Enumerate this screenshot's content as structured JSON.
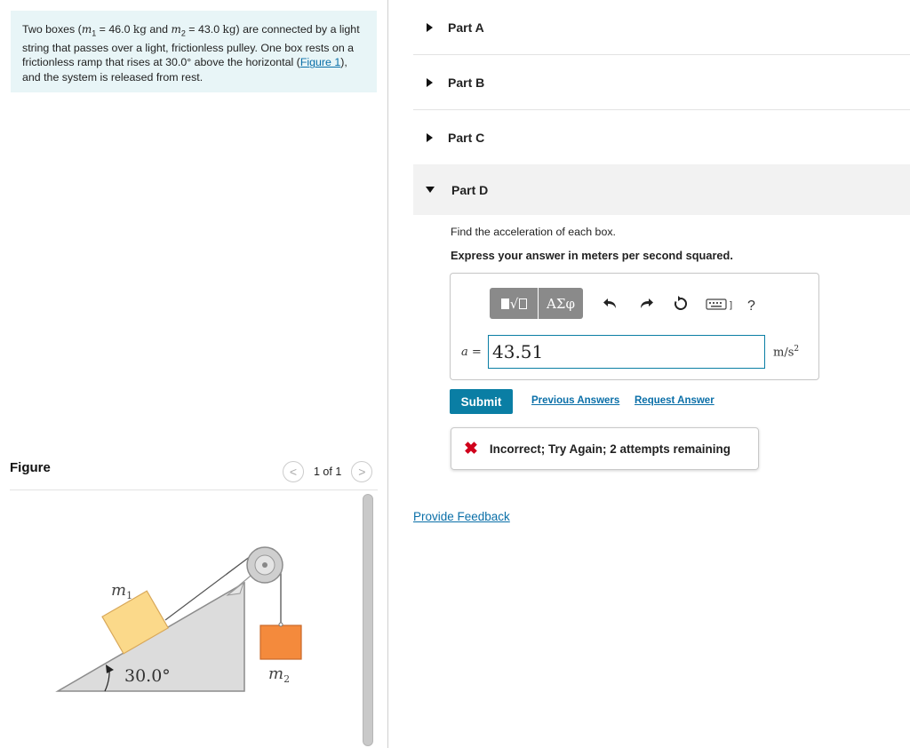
{
  "problem": {
    "t1": "Two boxes (",
    "m1_sym": "m",
    "m1_sub": "1",
    "m1_val": " = 46.0",
    "unit_kg": "kg",
    "t2": " and ",
    "m2_sym": "m",
    "m2_sub": "2",
    "m2_val": " = 43.0",
    "unit_kg2": "kg",
    "t3": ") are connected by a light string that passes over a light, frictionless pulley. One box rests on a frictionless ramp that rises at 30.0° above the horizontal (",
    "figure_link": "Figure 1",
    "t4": "), and the system is released from rest."
  },
  "figure": {
    "title": "Figure",
    "prev": "<",
    "count": "1 of 1",
    "next": ">",
    "label_m1": "m",
    "label_m1_sub": "1",
    "label_m2": "m",
    "label_m2_sub": "2",
    "angle": "30.0°",
    "colors": {
      "box1": "#fbd98a",
      "box2": "#f48a3c",
      "ramp": "#dcdcdc",
      "pulley": "#cfcfcf"
    }
  },
  "parts": [
    {
      "label": "Part A"
    },
    {
      "label": "Part B"
    },
    {
      "label": "Part C"
    },
    {
      "label": "Part D"
    }
  ],
  "partD": {
    "question": "Find the acceleration of each box.",
    "instruction": "Express your answer in meters per second squared.",
    "toolbar": {
      "templates_icon": "templates-icon",
      "greek_label": "ΑΣφ",
      "undo_icon": "undo-icon",
      "redo_icon": "redo-icon",
      "reset_icon": "reset-icon",
      "keyboard_icon": "keyboard-icon",
      "help_label": "?"
    },
    "answer_var": "a",
    "answer_eq": " =",
    "answer_value": "43.51",
    "unit_base": "m/s",
    "unit_exp": "2",
    "submit": "Submit",
    "previous_answers": "Previous Answers",
    "request_answer": "Request Answer",
    "feedback_icon": "x-icon",
    "feedback": "Incorrect; Try Again; 2 attempts remaining"
  },
  "provide_feedback": "Provide Feedback",
  "colors": {
    "accent": "#0a7ea4",
    "link": "#0a6fa8",
    "error": "#d0021b",
    "problem_bg": "#e8f5f7"
  }
}
